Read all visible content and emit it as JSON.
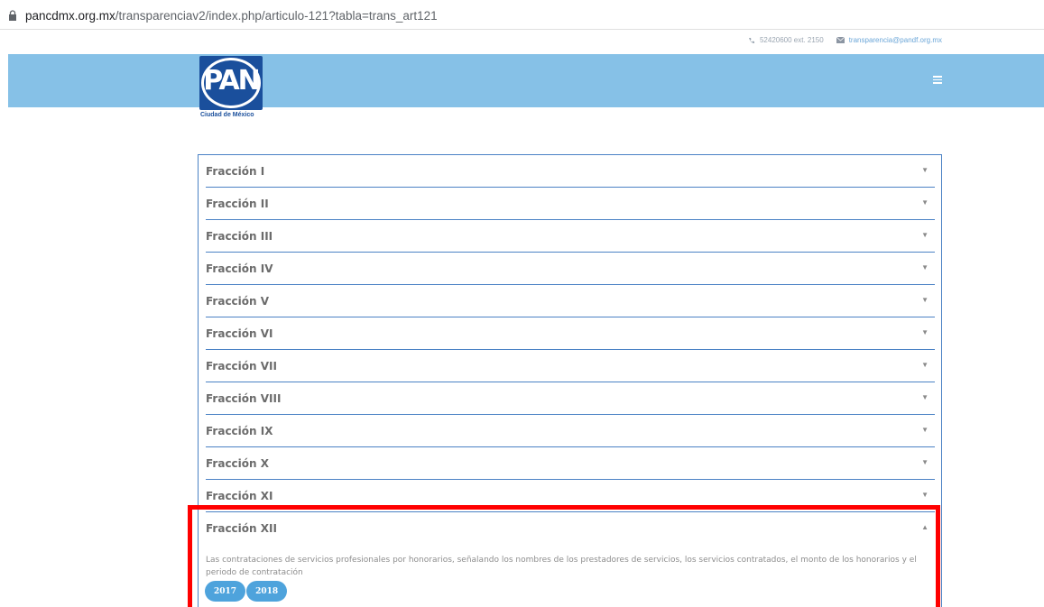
{
  "browser": {
    "url_host": "pancdmx.org.mx",
    "url_path": "/transparenciav2/index.php/articulo-121?tabla=trans_art121"
  },
  "topbar": {
    "phone": "52420600 ext. 2150",
    "email": "transparencia@pandf.org.mx"
  },
  "logo": {
    "text": "PAN",
    "caption": "Ciudad de México",
    "color": "#1a4f9c"
  },
  "colors": {
    "nav": "#86c1e7",
    "accent": "#4b82c5",
    "highlight": "#ff0000",
    "year_button": "#4ea3dc"
  },
  "accordion": {
    "items": [
      {
        "label": "Fracción I",
        "arrow": "▼"
      },
      {
        "label": "Fracción II",
        "arrow": "▼"
      },
      {
        "label": "Fracción III",
        "arrow": "▼"
      },
      {
        "label": "Fracción IV",
        "arrow": "▼"
      },
      {
        "label": "Fracción V",
        "arrow": "▼"
      },
      {
        "label": "Fracción VI",
        "arrow": "▼"
      },
      {
        "label": "Fracción VII",
        "arrow": "▼"
      },
      {
        "label": "Fracción VIII",
        "arrow": "▼"
      },
      {
        "label": "Fracción IX",
        "arrow": "▼"
      },
      {
        "label": "Fracción X",
        "arrow": "▼"
      },
      {
        "label": "Fracción XI",
        "arrow": "▼"
      },
      {
        "label": "Fracción XII",
        "arrow": "▲"
      }
    ],
    "expanded": {
      "description": "Las contrataciones de servicios profesionales por honorarios, señalando los nombres de los prestadores de servicios, los servicios contratados, el monto de los honorarios y el periodo de contratación",
      "years": [
        "2017",
        "2018"
      ]
    }
  }
}
